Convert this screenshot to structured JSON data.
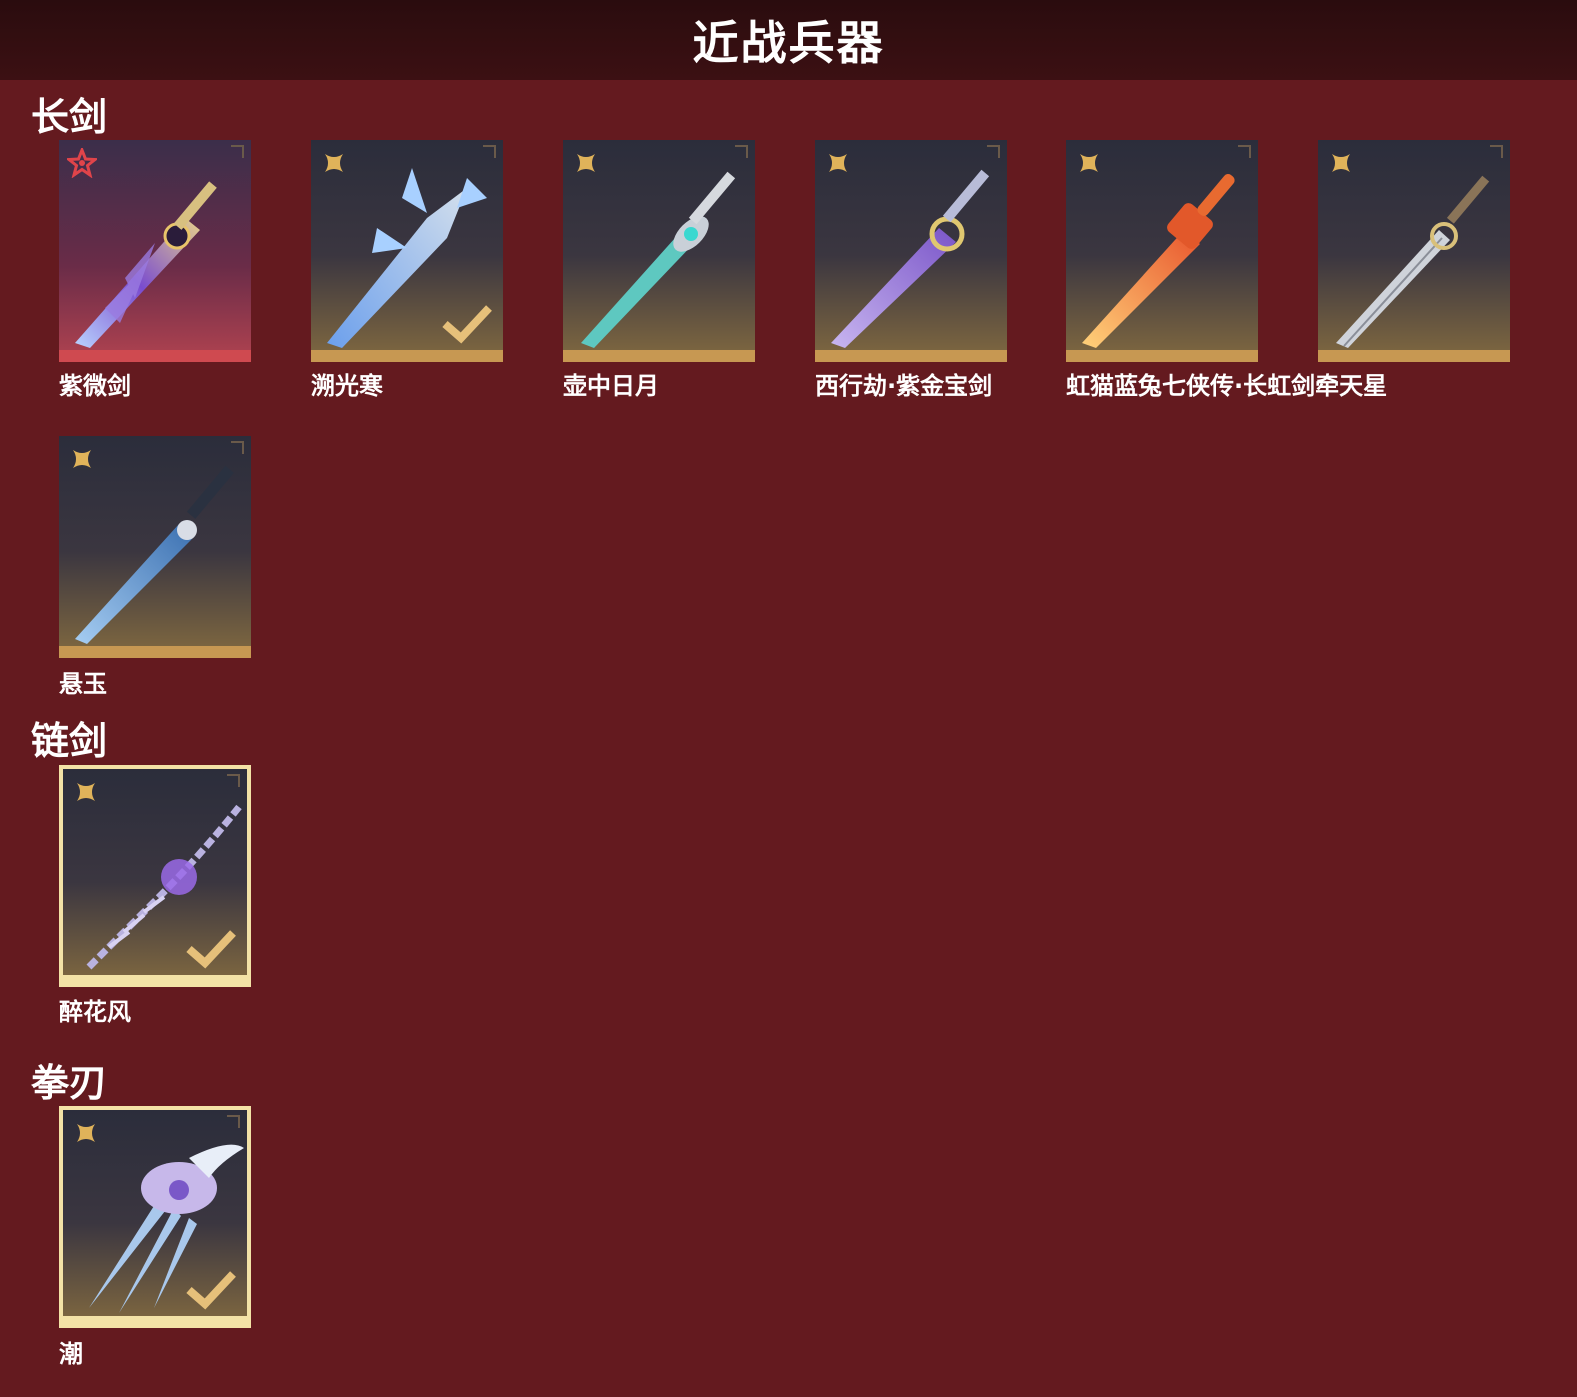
{
  "page_title": "近战兵器",
  "colors": {
    "background": "#641a1f",
    "header": "#2e0e10",
    "gold": "#c79852",
    "red_rarity": "#cf4a50",
    "selected_border": "#f3e2a6"
  },
  "sections": [
    {
      "title": "长剑",
      "items": [
        {
          "name": "紫微剑",
          "rarity": "red",
          "rank_icon": "red-star-icon",
          "owned": false
        },
        {
          "name": "溯光寒",
          "rarity": "gold",
          "rank_icon": "gold-flower-icon",
          "owned": true
        },
        {
          "name": "壶中日月",
          "rarity": "gold",
          "rank_icon": "gold-flower-icon",
          "owned": false
        },
        {
          "name": "西行劫·紫金宝剑",
          "rarity": "gold",
          "rank_icon": "gold-flower-icon",
          "owned": false
        },
        {
          "name": "虹猫蓝兔七侠传·长虹剑牵天星",
          "rarity": "gold",
          "rank_icon": "gold-flower-icon",
          "owned": false
        },
        {
          "name": "",
          "rarity": "gold",
          "rank_icon": "gold-flower-icon",
          "owned": false
        },
        {
          "name": "悬玉",
          "rarity": "gold",
          "rank_icon": "gold-flower-icon",
          "owned": false
        }
      ]
    },
    {
      "title": "链剑",
      "items": [
        {
          "name": "醉花风",
          "rarity": "gold",
          "rank_icon": "gold-flower-icon",
          "owned": true,
          "selected": true
        }
      ]
    },
    {
      "title": "拳刃",
      "items": [
        {
          "name": "潮",
          "rarity": "gold",
          "rank_icon": "gold-flower-icon",
          "owned": true,
          "selected": true
        }
      ]
    }
  ]
}
